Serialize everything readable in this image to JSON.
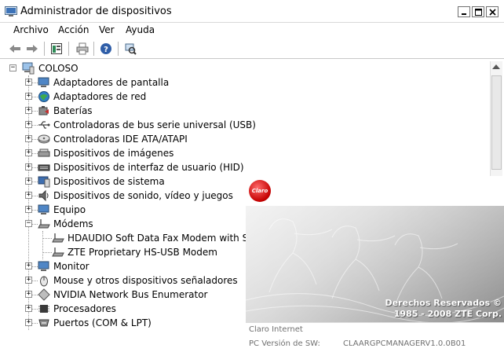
{
  "window": {
    "title": "Administrador de dispositivos"
  },
  "menu": {
    "archivo": "Archivo",
    "accion": "Acción",
    "ver": "Ver",
    "ayuda": "Ayuda"
  },
  "toolbar": {
    "icons": [
      "back-arrow-icon",
      "forward-arrow-icon",
      "properties-icon",
      "print-icon",
      "help-icon",
      "scan-hardware-icon"
    ]
  },
  "tree": {
    "root": "COLOSO",
    "items": [
      {
        "label": "Adaptadores de pantalla",
        "icon": "display-adapter-icon"
      },
      {
        "label": "Adaptadores de red",
        "icon": "network-adapter-icon"
      },
      {
        "label": "Baterías",
        "icon": "battery-icon"
      },
      {
        "label": "Controladoras de bus serie universal (USB)",
        "icon": "usb-icon"
      },
      {
        "label": "Controladoras IDE ATA/ATAPI",
        "icon": "ide-controller-icon"
      },
      {
        "label": "Dispositivos de imágenes",
        "icon": "imaging-device-icon"
      },
      {
        "label": "Dispositivos de interfaz de usuario (HID)",
        "icon": "hid-icon"
      },
      {
        "label": "Dispositivos de sistema",
        "icon": "system-device-icon"
      },
      {
        "label": "Dispositivos de sonido, vídeo y juegos",
        "icon": "sound-device-icon"
      },
      {
        "label": "Equipo",
        "icon": "computer-icon"
      },
      {
        "label": "Módems",
        "icon": "modem-icon"
      },
      {
        "label": "HDAUDIO Soft Data Fax Modem with Smart",
        "icon": "modem-icon"
      },
      {
        "label": "ZTE Proprietary HS-USB Modem",
        "icon": "modem-icon"
      },
      {
        "label": "Monitor",
        "icon": "monitor-icon"
      },
      {
        "label": "Mouse y otros dispositivos señaladores",
        "icon": "mouse-icon"
      },
      {
        "label": "NVIDIA Network Bus Enumerator",
        "icon": "bus-enumerator-icon"
      },
      {
        "label": "Procesadores",
        "icon": "processor-icon"
      },
      {
        "label": "Puertos (COM & LPT)",
        "icon": "port-icon"
      }
    ]
  },
  "splash": {
    "logo_text": "Claro",
    "copyright_line1": "Derechos Reservados ©",
    "copyright_line2": "1985 - 2008 ZTE Corp.",
    "company": "Claro Internet",
    "version_label": "PC Versión de SW:",
    "version_value": "CLAARGPCMANAGERV1.0.0B01"
  }
}
